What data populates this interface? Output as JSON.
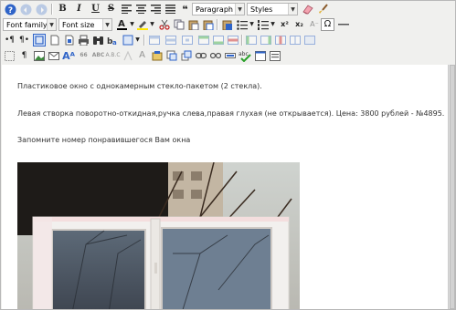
{
  "toolbar": {
    "format_select": "Paragraph",
    "styles_select": "Styles",
    "font_family_select": "Font family",
    "font_size_select": "Font size",
    "bold_label": "B",
    "italic_label": "I",
    "underline_label": "U",
    "strike_label": "S",
    "quote_label": "❝",
    "font_color_label": "A",
    "superscript_label": "x²",
    "subscript_label": "x₂",
    "omega_label": "Ω",
    "abbr_label": "Aᴬ",
    "abc_label": "ABC",
    "spell_label": "abc",
    "accent_color": "#1a57c9",
    "red_color": "#d11f1f",
    "highlight_color": "#ffe600"
  },
  "content": {
    "line1": "Пластиковое окно с однокамерным стекло-пакетом (2 стекла).",
    "line2": "Левая створка поворотно-откидная,ручка слева,правая глухая (не открывается). Цена: 3800 рублей - №4895.",
    "line3": "Запомните номер понравившегося Вам окна",
    "photo": "plastic-window-photo"
  }
}
